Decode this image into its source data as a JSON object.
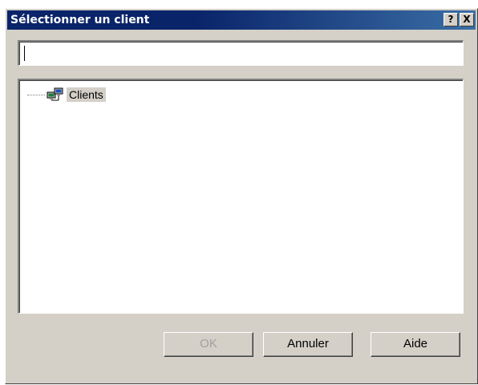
{
  "window": {
    "title": "Sélectionner un client",
    "help_button": "?",
    "close_button": "X"
  },
  "search": {
    "value": ""
  },
  "tree": {
    "items": [
      {
        "label": "Clients",
        "icon": "network-computers-icon",
        "selected": true
      }
    ]
  },
  "buttons": {
    "ok": "OK",
    "cancel": "Annuler",
    "help": "Aide"
  },
  "colors": {
    "titlebar": "#0a246a",
    "dialog_bg": "#d4d0c8",
    "disabled_text": "#a0a0a0"
  }
}
